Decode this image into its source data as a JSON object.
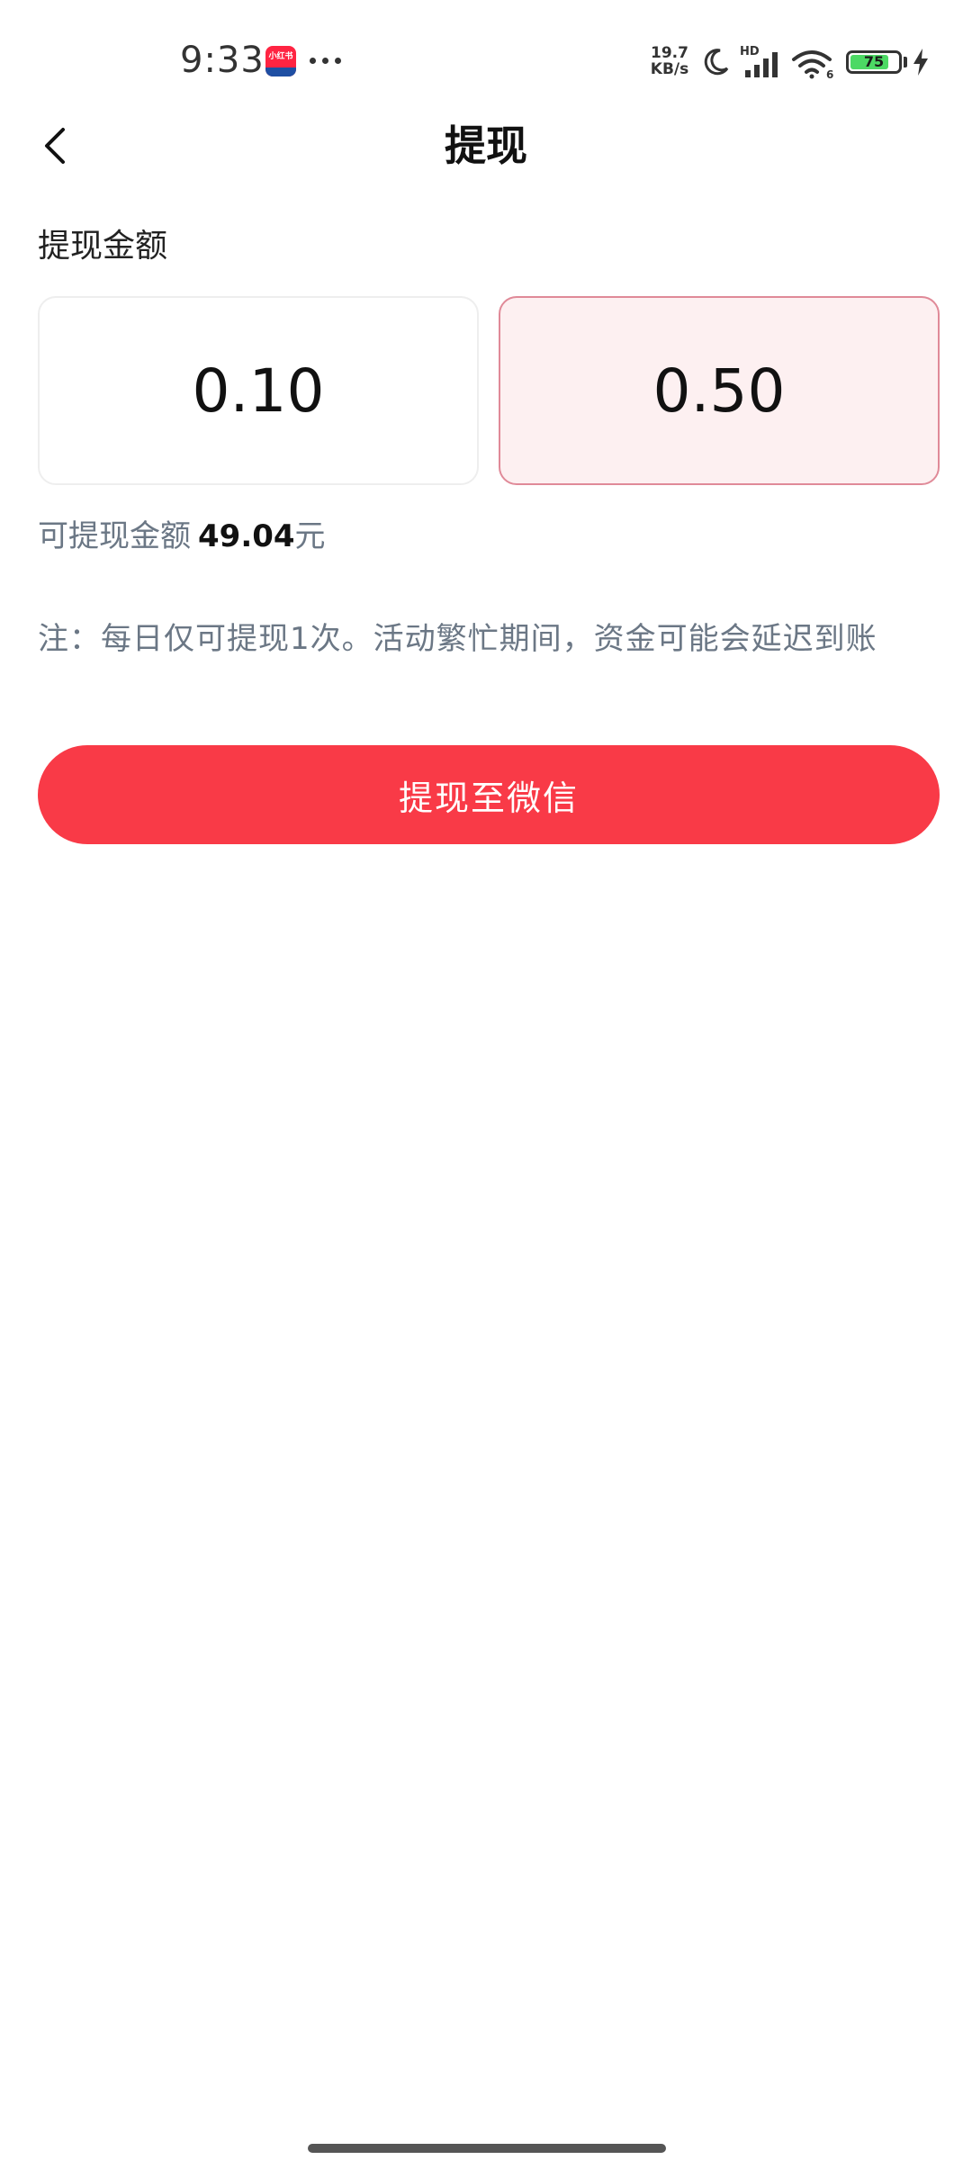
{
  "status_bar": {
    "time": "9:33",
    "app_icon_text": "小红书",
    "net_speed_value": "19.7",
    "net_speed_unit": "KB/s",
    "network_label": "HD",
    "wifi_label": "6",
    "battery_level": "75",
    "battery_color": "#4cd964"
  },
  "nav": {
    "back_icon": "chevron-left-icon",
    "title": "提现"
  },
  "withdraw": {
    "section_label": "提现金额",
    "options": [
      {
        "amount": "0.10",
        "selected": false
      },
      {
        "amount": "0.50",
        "selected": true
      }
    ],
    "available_label": "可提现金额",
    "available_value": "49.04",
    "available_unit": "元",
    "note": "注：每日仅可提现1次。活动繁忙期间，资金可能会延迟到账",
    "button_label": "提现至微信",
    "accent_color": "#f93a47"
  }
}
